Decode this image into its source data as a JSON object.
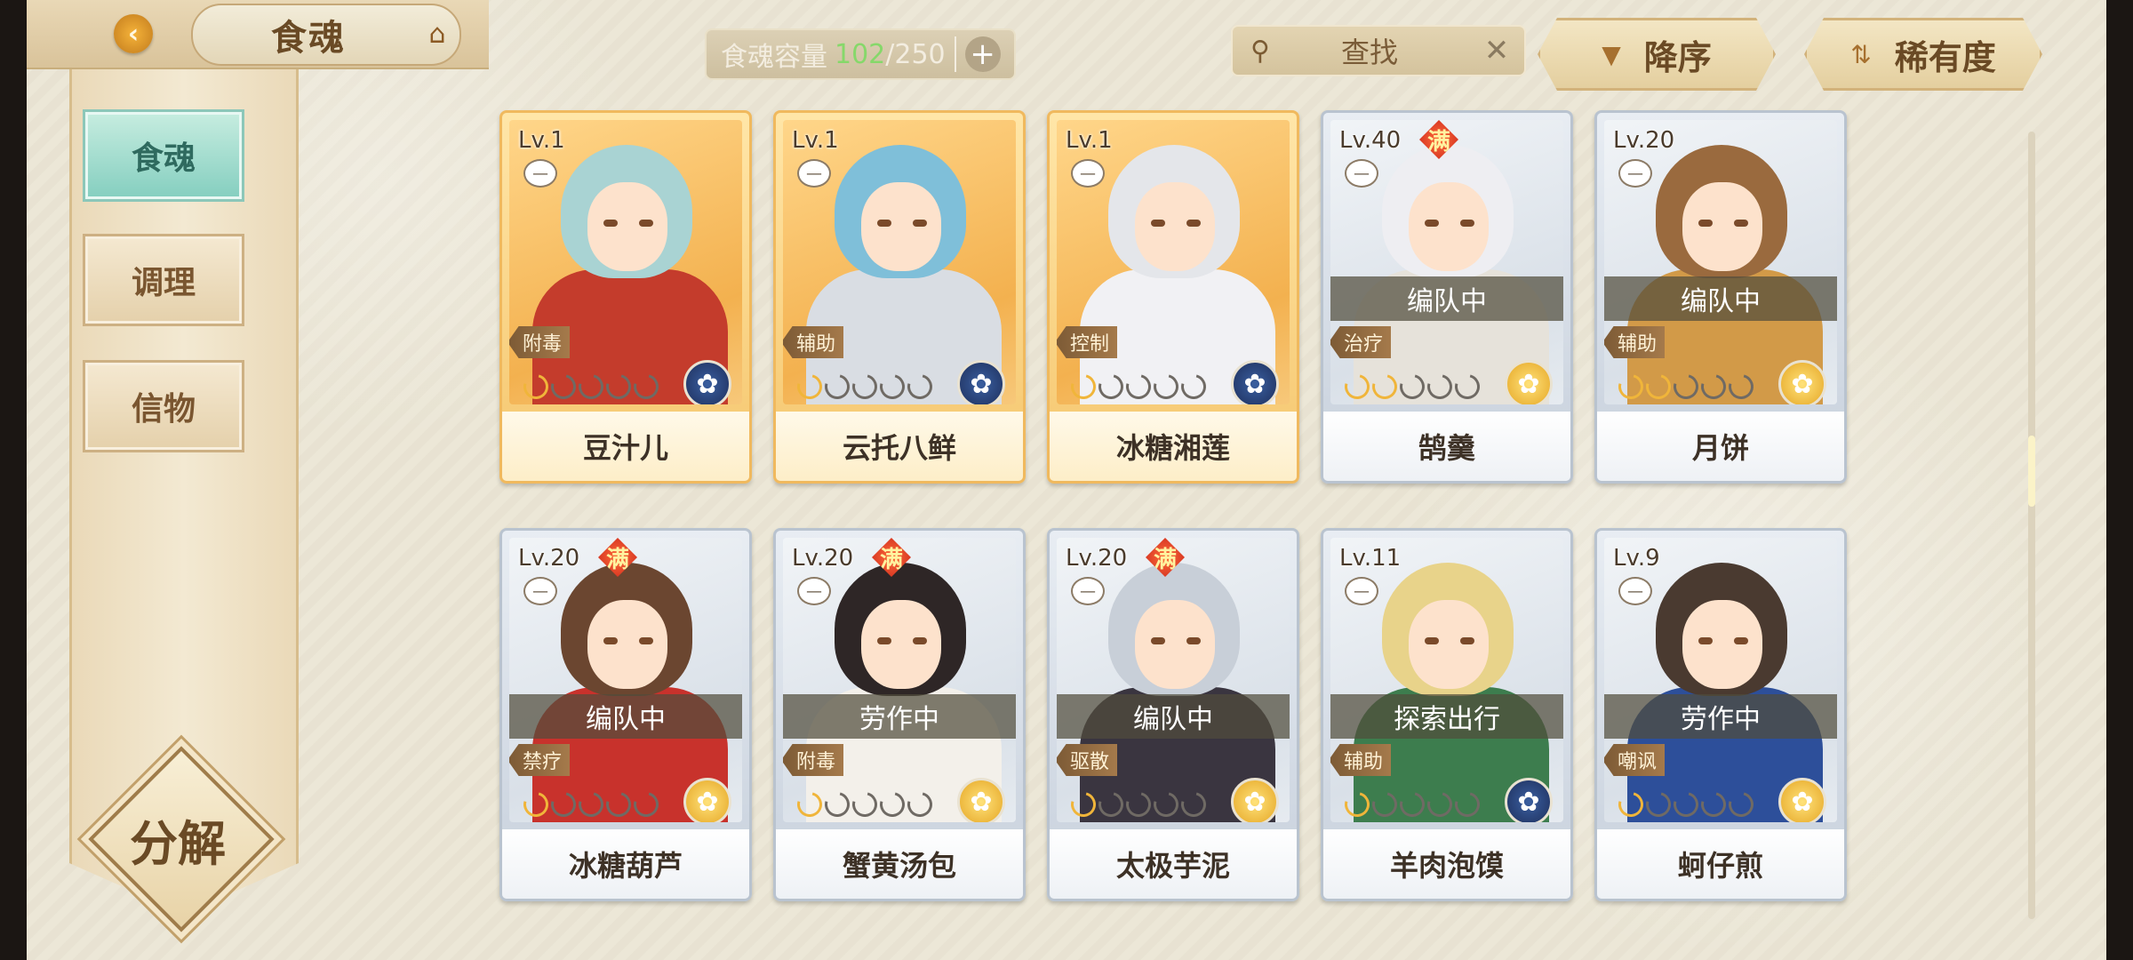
{
  "header": {
    "title": "食魂",
    "back_icon": "back-arrow-icon",
    "home_icon": "pavilion-icon"
  },
  "capacity": {
    "label": "食魂容量",
    "current": "102",
    "max": "/250",
    "plus_label": "+"
  },
  "search": {
    "label": "查找",
    "clear": "✕"
  },
  "sort": {
    "order_label": "降序",
    "rarity_label": "稀有度"
  },
  "sidebar": {
    "tabs": [
      {
        "label": "食魂",
        "active": true
      },
      {
        "label": "调理",
        "active": false
      },
      {
        "label": "信物",
        "active": false
      }
    ],
    "decompose_label": "分解"
  },
  "cards": [
    {
      "level": "Lv.1",
      "name": "豆汁儿",
      "role": "附毒",
      "status": "",
      "max": false,
      "stars": 1,
      "frame": "gold",
      "element": "blue",
      "hair": "#a9d3d3",
      "body": "#c43c2c"
    },
    {
      "level": "Lv.1",
      "name": "云托八鲜",
      "role": "辅助",
      "status": "",
      "max": false,
      "stars": 1,
      "frame": "gold",
      "element": "blue",
      "hair": "#7fbfd9",
      "body": "#d9dde3"
    },
    {
      "level": "Lv.1",
      "name": "冰糖湘莲",
      "role": "控制",
      "status": "",
      "max": false,
      "stars": 1,
      "frame": "gold",
      "element": "blue",
      "hair": "#e4e6ea",
      "body": "#f1f1f4"
    },
    {
      "level": "Lv.40",
      "name": "鹄羹",
      "role": "治疗",
      "status": "编队中",
      "max": true,
      "stars": 2,
      "frame": "silver",
      "element": "gold",
      "hair": "#eeeef2",
      "body": "#e6e2da"
    },
    {
      "level": "Lv.20",
      "name": "月饼",
      "role": "辅助",
      "status": "编队中",
      "max": false,
      "stars": 2,
      "frame": "silver",
      "element": "gold",
      "hair": "#9a6a3e",
      "body": "#d29a48"
    },
    {
      "level": "Lv.20",
      "name": "冰糖葫芦",
      "role": "禁疗",
      "status": "编队中",
      "max": true,
      "stars": 1,
      "frame": "silver",
      "element": "gold",
      "hair": "#6b4630",
      "body": "#c8322c"
    },
    {
      "level": "Lv.20",
      "name": "蟹黄汤包",
      "role": "附毒",
      "status": "劳作中",
      "max": true,
      "stars": 1,
      "frame": "silver",
      "element": "gold",
      "hair": "#2e2626",
      "body": "#f3f0ea"
    },
    {
      "level": "Lv.20",
      "name": "太极芋泥",
      "role": "驱散",
      "status": "编队中",
      "max": true,
      "stars": 1,
      "frame": "silver",
      "element": "gold",
      "hair": "#c8cfd8",
      "body": "#3a3540"
    },
    {
      "level": "Lv.11",
      "name": "羊肉泡馍",
      "role": "辅助",
      "status": "探索出行",
      "max": false,
      "stars": 1,
      "frame": "silver",
      "element": "blue",
      "hair": "#e8d38a",
      "body": "#3d7d4e"
    },
    {
      "level": "Lv.9",
      "name": "蚵仔煎",
      "role": "嘲讽",
      "status": "劳作中",
      "max": false,
      "stars": 1,
      "frame": "silver",
      "element": "gold",
      "hair": "#4a3a30",
      "body": "#2d4f9a"
    }
  ],
  "max_badge_label": "满"
}
